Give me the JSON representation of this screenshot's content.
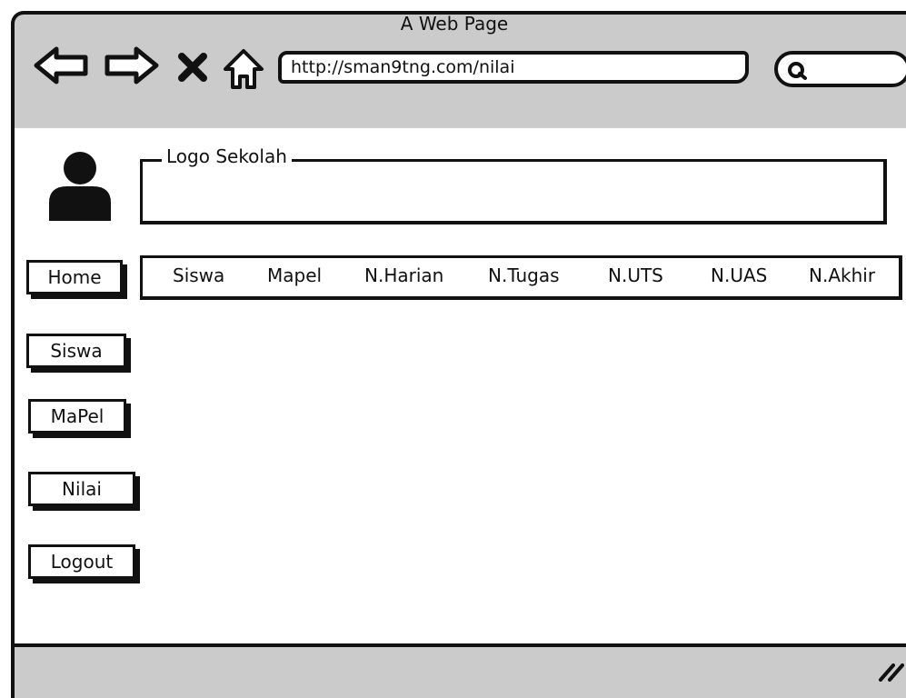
{
  "window": {
    "title": "A Web Page",
    "url": "http://sman9tng.com/nilai"
  },
  "header": {
    "logo_label": "Logo Sekolah"
  },
  "sidebar": {
    "items": [
      {
        "label": "Home"
      },
      {
        "label": "Siswa"
      },
      {
        "label": "MaPel"
      },
      {
        "label": "Nilai"
      },
      {
        "label": "Logout"
      }
    ]
  },
  "menu": {
    "items": [
      {
        "label": "Siswa"
      },
      {
        "label": "Mapel"
      },
      {
        "label": "N.Harian"
      },
      {
        "label": "N.Tugas"
      },
      {
        "label": "N.UTS"
      },
      {
        "label": "N.UAS"
      },
      {
        "label": "N.Akhir"
      }
    ]
  },
  "icons": {
    "back": "back-arrow-icon",
    "forward": "forward-arrow-icon",
    "stop": "close-icon",
    "home": "home-icon",
    "search": "search-icon",
    "avatar": "user-icon",
    "resize": "resize-grip-icon"
  }
}
